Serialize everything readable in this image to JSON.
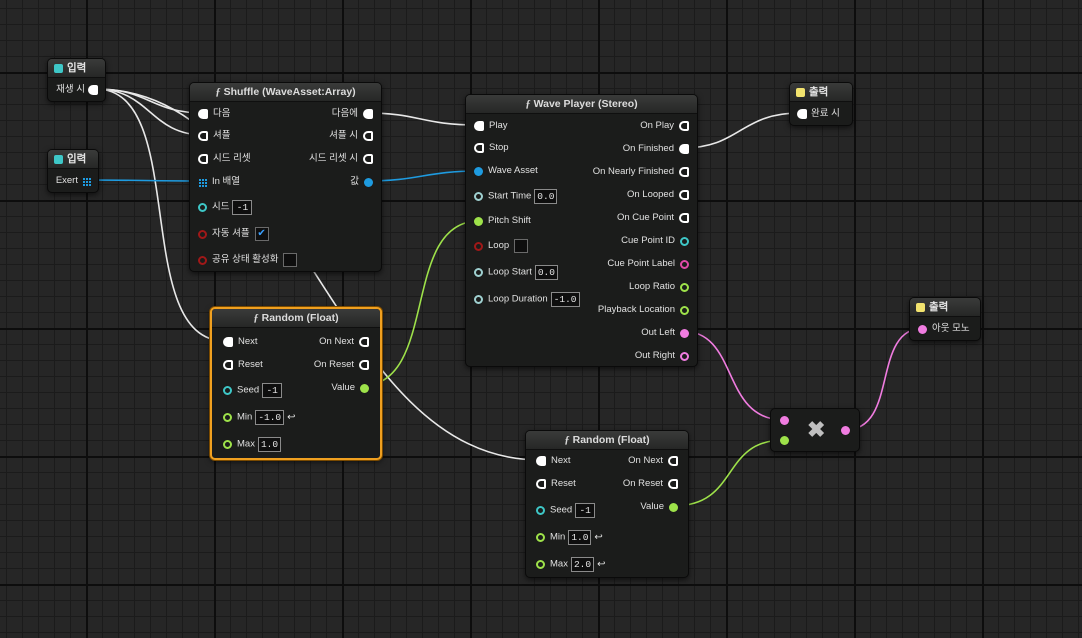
{
  "colors": {
    "exec": "#ffffff",
    "wave_asset": "#1e9be0",
    "float": "#9ee24a",
    "int": "#3ec7c7",
    "bool": "#a01818",
    "string": "#e04aa8",
    "audio": "#f07ce0",
    "selected": "#f0a020"
  },
  "input_play": {
    "title": "입력",
    "icon": "input-icon",
    "pin": "재생 시"
  },
  "input_exert": {
    "title": "입력",
    "icon": "input-icon",
    "pin": "Exert"
  },
  "shuffle": {
    "title": "Shuffle (WaveAsset:Array)",
    "in_next": "다음",
    "in_shuffle": "셔플",
    "in_reset_seed": "시드 리셋",
    "in_array": "In 배열",
    "in_seed": "시드",
    "seed_value": "-1",
    "in_auto_shuffle": "자동 셔플",
    "auto_shuffle_checked": true,
    "in_shared_state": "공유 상태 활성화",
    "out_on_next": "다음에",
    "out_on_shuffle": "셔플 시",
    "out_on_reset_seed": "시드 리셋 시",
    "out_value": "값"
  },
  "wave_player": {
    "title": "Wave Player (Stereo)",
    "in_play": "Play",
    "in_stop": "Stop",
    "in_wave_asset": "Wave Asset",
    "in_start_time": "Start Time",
    "start_time_value": "0.0",
    "in_pitch_shift": "Pitch Shift",
    "in_loop": "Loop",
    "in_loop_start": "Loop Start",
    "loop_start_value": "0.0",
    "in_loop_duration": "Loop Duration",
    "loop_duration_value": "-1.0",
    "out_on_play": "On Play",
    "out_on_finished": "On Finished",
    "out_on_nearly_finished": "On Nearly Finished",
    "out_on_looped": "On Looped",
    "out_on_cue_point": "On Cue Point",
    "out_cue_point_id": "Cue Point ID",
    "out_cue_point_label": "Cue Point Label",
    "out_loop_ratio": "Loop Ratio",
    "out_playback_location": "Playback Location",
    "out_left": "Out Left",
    "out_right": "Out Right"
  },
  "random1": {
    "title": "Random (Float)",
    "in_next": "Next",
    "in_reset": "Reset",
    "in_seed": "Seed",
    "seed_value": "-1",
    "in_min": "Min",
    "min_value": "-1.0",
    "in_max": "Max",
    "max_value": "1.0",
    "out_on_next": "On Next",
    "out_on_reset": "On Reset",
    "out_value": "Value"
  },
  "random2": {
    "title": "Random (Float)",
    "in_next": "Next",
    "in_reset": "Reset",
    "in_seed": "Seed",
    "seed_value": "-1",
    "in_min": "Min",
    "min_value": "1.0",
    "in_max": "Max",
    "max_value": "2.0",
    "out_on_next": "On Next",
    "out_on_reset": "On Reset",
    "out_value": "Value"
  },
  "output_finished": {
    "title": "출력",
    "icon": "output-icon",
    "pin": "완료 시"
  },
  "output_mono": {
    "title": "출력",
    "icon": "output-icon",
    "pin": "아웃 모노"
  },
  "multiply": {
    "symbol": "✖"
  }
}
